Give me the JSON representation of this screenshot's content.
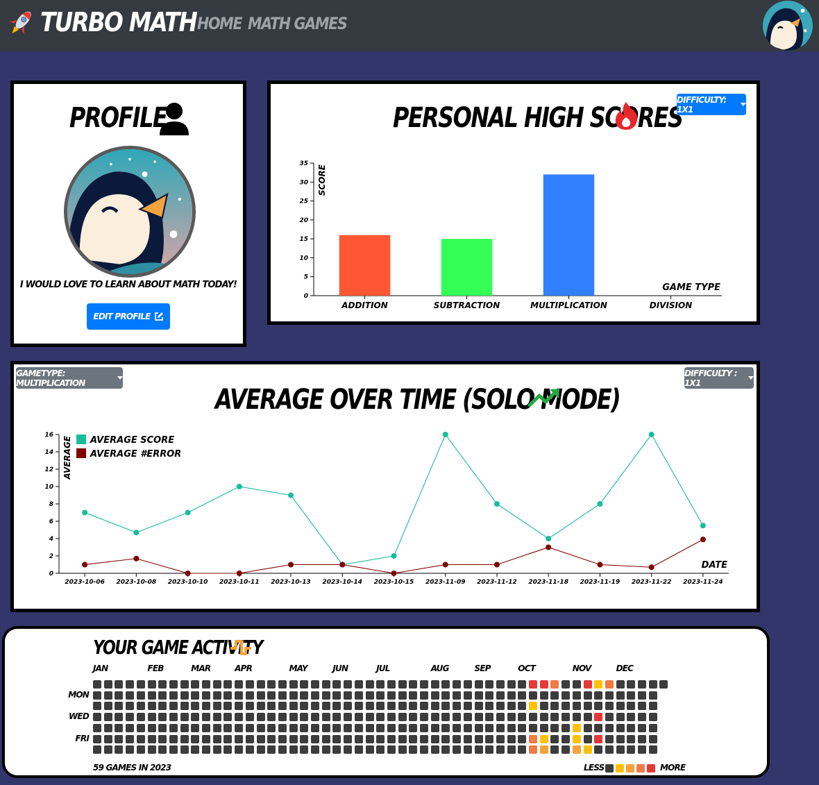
{
  "navbar": {
    "brand": "TURBO MATH",
    "links": [
      "HOME",
      "MATH GAMES"
    ]
  },
  "profile": {
    "title": "PROFILE",
    "bio": "I WOULD LOVE TO LEARN ABOUT MATH TODAY!",
    "edit_button": "EDIT PROFILE"
  },
  "high_scores": {
    "title": "PERSONAL HIGH SCORES",
    "difficulty_button": "DIFFICULTY: 1X1"
  },
  "average": {
    "title": "AVERAGE OVER TIME (SOLO MODE)",
    "gametype_button": "GAMETYPE: MULTIPLICATION",
    "difficulty_button": "DIFFICULTY : 1X1"
  },
  "activity": {
    "title": "YOUR GAME ACTIVITY",
    "months": [
      "JAN",
      "FEB",
      "MAR",
      "APR",
      "MAY",
      "JUN",
      "JUL",
      "AUG",
      "SEP",
      "OCT",
      "NOV",
      "DEC"
    ],
    "days": [
      "MON",
      "WED",
      "FRI"
    ],
    "total": "59 GAMES IN 2023",
    "legend_less": "LESS",
    "legend_more": "MORE",
    "scale_colors": [
      "#3c3c3c",
      "#ffc107",
      "#f6a23a",
      "#ef7b45",
      "#e53935"
    ]
  },
  "colors": {
    "navbar": "#343a40",
    "page_bg": "#32366a",
    "primary_button": "#007bff",
    "secondary_button": "#6c757d",
    "trend_icon": "#28a745",
    "fire_icon": "#e8272b"
  },
  "chart_data": [
    {
      "type": "bar",
      "categories": [
        "ADDITION",
        "SUBTRACTION",
        "MULTIPLICATION",
        "DIVISION"
      ],
      "values": [
        16,
        15,
        32,
        0
      ],
      "colors": [
        "#ff5733",
        "#33ff57",
        "#3380ff",
        "#ff33a8"
      ],
      "xlabel": "GAME TYPE",
      "ylabel": "SCORE",
      "ylim": [
        0,
        35
      ],
      "yticks": [
        0,
        5,
        10,
        15,
        20,
        25,
        30,
        35
      ],
      "grid": false
    },
    {
      "type": "line",
      "x": [
        "2023-10-06",
        "2023-10-08",
        "2023-10-10",
        "2023-10-11",
        "2023-10-13",
        "2023-10-14",
        "2023-10-15",
        "2023-11-09",
        "2023-11-12",
        "2023-11-18",
        "2023-11-19",
        "2023-11-22",
        "2023-11-24"
      ],
      "series": [
        {
          "name": "AVERAGE SCORE",
          "color": "#1abc9c",
          "values": [
            7,
            4.7,
            7,
            10,
            9,
            1,
            2,
            16,
            8,
            4,
            8,
            16,
            5.5
          ]
        },
        {
          "name": "AVERAGE #ERROR",
          "color": "#800000",
          "values": [
            1,
            1.7,
            0,
            0,
            1,
            1,
            0,
            1,
            1,
            3,
            1,
            0.7,
            3.9
          ]
        }
      ],
      "xlabel": "DATE",
      "ylabel": "AVERAGE",
      "ylim": [
        0,
        16
      ],
      "yticks": [
        0,
        2,
        4,
        6,
        8,
        10,
        12,
        14,
        16
      ],
      "legend": "top-left",
      "grid": false
    }
  ]
}
